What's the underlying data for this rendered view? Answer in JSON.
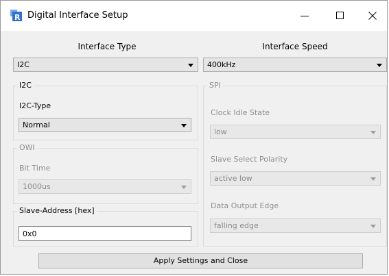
{
  "window": {
    "title": "Digital Interface Setup",
    "minimize_icon": "minimize-icon",
    "maximize_icon": "maximize-icon",
    "close_icon": "close-icon"
  },
  "interface_type": {
    "label": "Interface Type",
    "value": "I2C"
  },
  "interface_speed": {
    "label": "Interface Speed",
    "value": "400kHz"
  },
  "i2c_group": {
    "title": "I2C",
    "type_label": "I2C-Type",
    "type_value": "Normal"
  },
  "spi_group": {
    "title": "SPI",
    "clock_idle_label": "Clock Idle State",
    "clock_idle_value": "low",
    "slave_select_label": "Slave Select Polarity",
    "slave_select_value": "active low",
    "data_output_label": "Data Output Edge",
    "data_output_value": "falling edge"
  },
  "owi_group": {
    "title": "OWI",
    "bit_time_label": "Bit Time",
    "bit_time_value": "1000us"
  },
  "slave_address": {
    "title": "Slave-Address [hex]",
    "value": "0x0"
  },
  "apply_button": {
    "label": "Apply Settings and Close"
  },
  "colors": {
    "icon_blue": "#2f6fd6",
    "icon_red": "#d8402b"
  }
}
